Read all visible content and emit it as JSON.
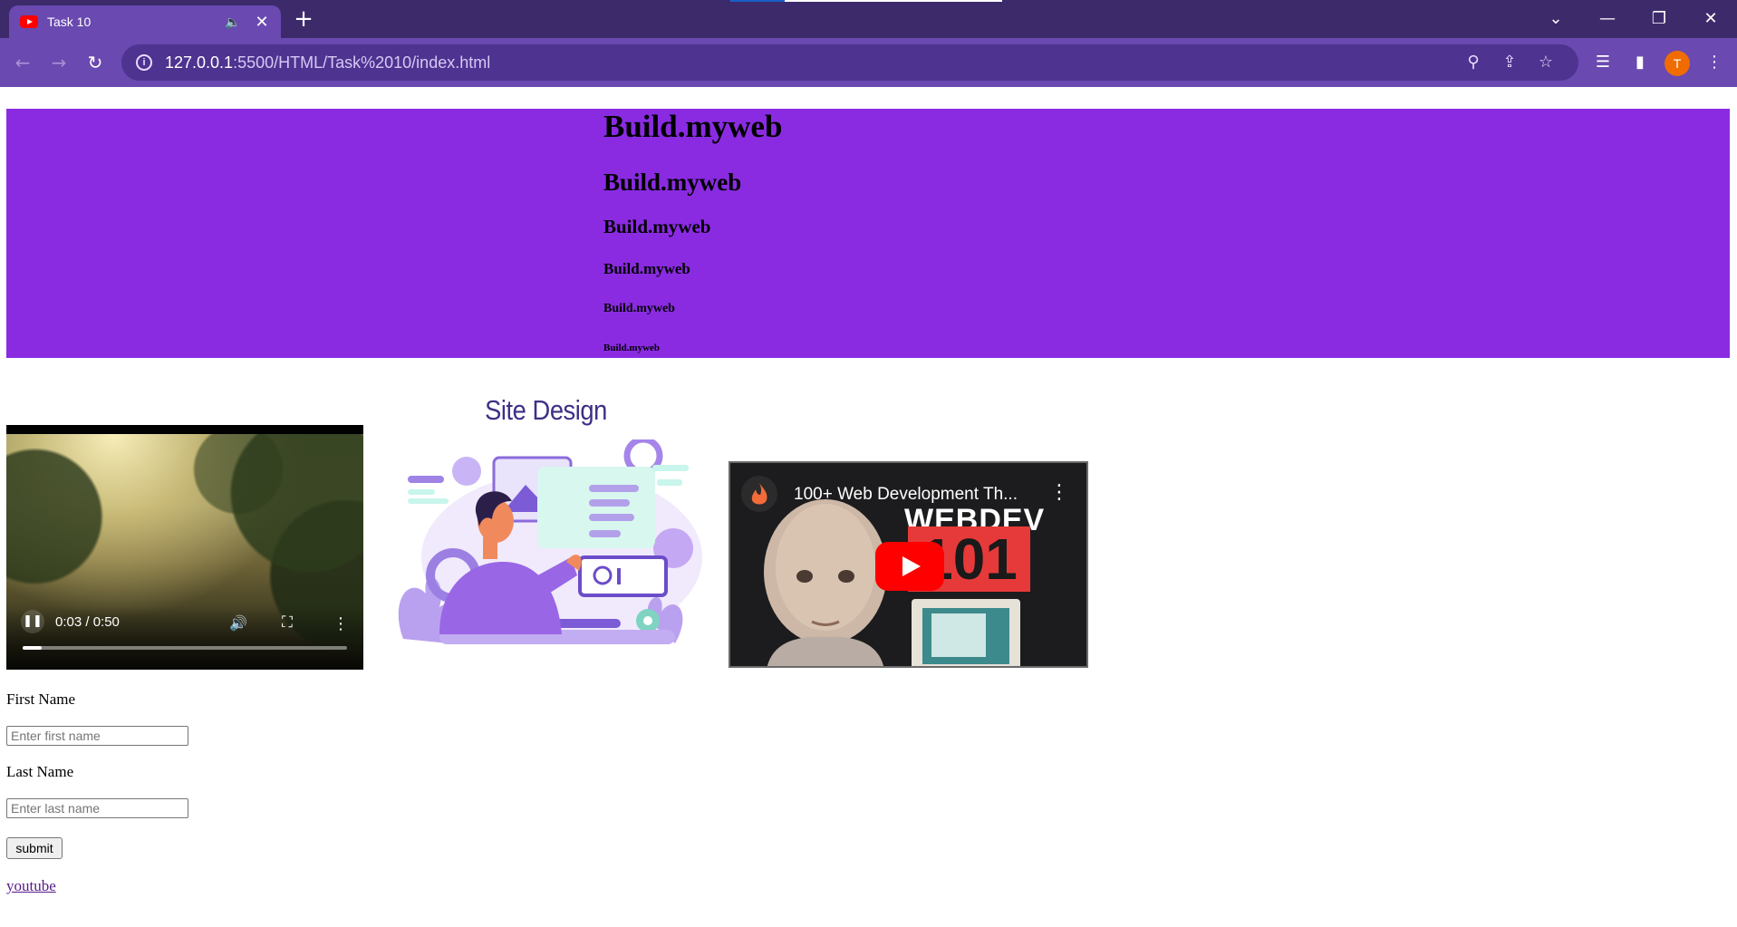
{
  "browser": {
    "tab": {
      "title": "Task 10",
      "mute_icon": "🔈",
      "close_icon": "✕"
    },
    "new_tab_icon": "+",
    "window": {
      "dropdown": "⌄",
      "minimize": "—",
      "restore": "❐",
      "close": "✕"
    },
    "nav": {
      "back": "←",
      "forward": "→",
      "reload": "↻"
    },
    "url": {
      "host": "127.0.0.1",
      "path": ":5500/HTML/Task%2010/index.html"
    },
    "omnibox_icons": {
      "info": "i",
      "zoom": "⚲",
      "share": "⇪",
      "bookmark": "☆"
    },
    "toolbar_icons": {
      "media": "☰",
      "sidepanel": "▮",
      "menu": "⋮"
    },
    "profile_initial": "T"
  },
  "page": {
    "headings": [
      "Build.myweb",
      "Build.myweb",
      "Build.myweb",
      "Build.myweb",
      "Build.myweb",
      "Build.myweb"
    ],
    "hero_color": "#8a2be2",
    "video": {
      "time": "0:03 / 0:50",
      "progress": 0.06,
      "play_state_icon": "❚❚",
      "volume_icon": "🔊",
      "fullscreen_icon": "⛶",
      "more_icon": "⋮"
    },
    "illustration": {
      "caption": "Site Design"
    },
    "youtube_embed": {
      "title": "100+ Web Development Th...",
      "thumbnail_text": "WEBDEV",
      "thumbnail_number": "101",
      "more_icon": "⋮"
    },
    "form": {
      "first_label": "First Name",
      "first_placeholder": "Enter first name",
      "last_label": "Last Name",
      "last_placeholder": "Enter last name",
      "submit_label": "submit"
    },
    "link": "youtube"
  }
}
